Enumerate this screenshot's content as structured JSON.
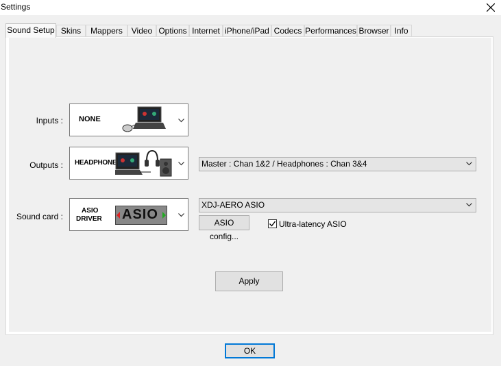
{
  "window": {
    "title": "Settings"
  },
  "tabs": [
    {
      "label": "Sound Setup",
      "active": true
    },
    {
      "label": "Skins"
    },
    {
      "label": "Mappers"
    },
    {
      "label": "Video"
    },
    {
      "label": "Options"
    },
    {
      "label": "Internet"
    },
    {
      "label": "iPhone/iPad"
    },
    {
      "label": "Codecs"
    },
    {
      "label": "Performances"
    },
    {
      "label": "Browser"
    },
    {
      "label": "Info"
    }
  ],
  "sound_setup": {
    "inputs": {
      "label": "Inputs :",
      "selected": "NONE"
    },
    "outputs": {
      "label": "Outputs :",
      "selected": "HEADPHONES",
      "routing": "Master : Chan 1&2 / Headphones : Chan 3&4"
    },
    "sound_card": {
      "label": "Sound card :",
      "selected_line1": "ASIO",
      "selected_line2": "DRIVER",
      "logo": "ASIO",
      "device": "XDJ-AERO ASIO",
      "config_button": "ASIO config...",
      "ultra_latency_label": "Ultra-latency ASIO",
      "ultra_latency_checked": true
    },
    "apply_label": "Apply"
  },
  "ok_label": "OK",
  "icons": [
    "close-icon",
    "chevron-down-icon",
    "checkmark-icon",
    "laptop-icon",
    "mouse-icon",
    "headphones-icon",
    "speaker-icon"
  ]
}
